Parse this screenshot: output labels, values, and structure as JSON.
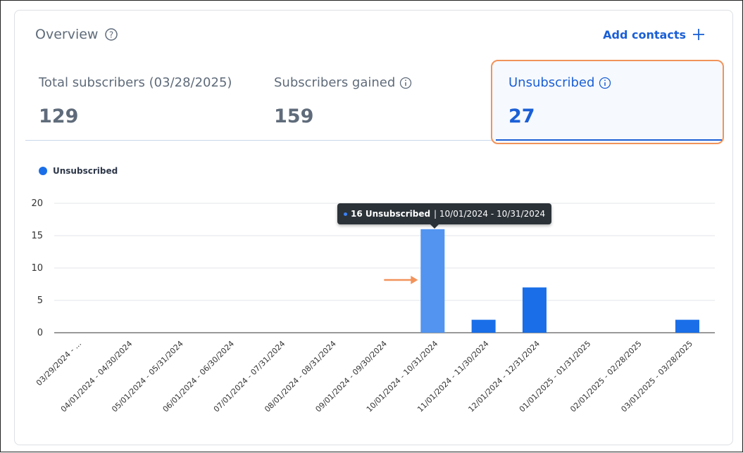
{
  "header": {
    "title": "Overview",
    "add_contacts_label": "Add contacts"
  },
  "metrics": {
    "total": {
      "label": "Total subscribers (03/28/2025)",
      "value": "129"
    },
    "gained": {
      "label": "Subscribers gained",
      "value": "159"
    },
    "unsubscribed": {
      "label": "Unsubscribed",
      "value": "27"
    }
  },
  "legend": {
    "label": "Unsubscribed"
  },
  "tooltip": {
    "value_text": "16 Unsubscribed",
    "range_text": "| 10/01/2024 - 10/31/2024"
  },
  "colors": {
    "accent": "#1a5fd6",
    "bar": "#1a6ee8",
    "bar_highlight": "#5294f0",
    "highlight_border": "#f2935a"
  },
  "chart_data": {
    "type": "bar",
    "categories": [
      "03/29/2024 - ...",
      "04/01/2024 - 04/30/2024",
      "05/01/2024 - 05/31/2024",
      "06/01/2024 - 06/30/2024",
      "07/01/2024 - 07/31/2024",
      "08/01/2024 - 08/31/2024",
      "09/01/2024 - 09/30/2024",
      "10/01/2024 - 10/31/2024",
      "11/01/2024 - 11/30/2024",
      "12/01/2024 - 12/31/2024",
      "01/01/2025 - 01/31/2025",
      "02/01/2025 - 02/28/2025",
      "03/01/2025 - 03/28/2025"
    ],
    "series": [
      {
        "name": "Unsubscribed",
        "values": [
          0,
          0,
          0,
          0,
          0,
          0,
          0,
          16,
          2,
          7,
          0,
          0,
          2
        ]
      }
    ],
    "highlighted_index": 7,
    "yticks": [
      0,
      5,
      10,
      15,
      20
    ],
    "ylim": [
      0,
      20
    ],
    "grid": true,
    "legend_position": "top-left"
  }
}
